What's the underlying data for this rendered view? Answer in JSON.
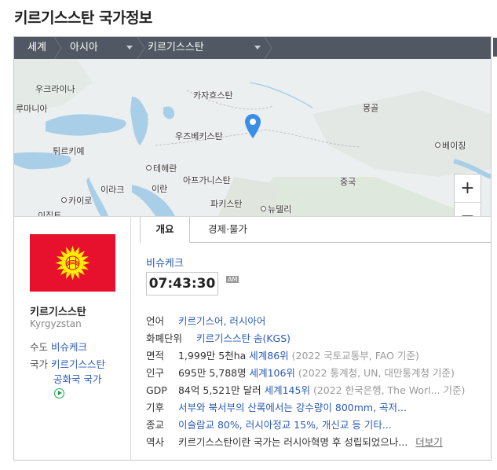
{
  "page_title": "키르기스스탄 국가정보",
  "breadcrumb": {
    "world": "세계",
    "region": "아시아",
    "country": "키르기스스탄"
  },
  "map": {
    "labels": {
      "ukraine": "우크라이나",
      "romania": "루마니아",
      "kazakhstan": "카자흐스탄",
      "mongolia": "몽골",
      "uzbekistan": "우즈베키스탄",
      "turkey": "튀르키예",
      "beijing": "베이징",
      "tehran": "테헤란",
      "afghanistan": "아프가니스탄",
      "china": "중국",
      "iraq": "이라크",
      "iran": "이란",
      "pakistan": "파키스탄",
      "cairo": "카이로",
      "newdelhi": "뉴델리",
      "egypt": "이집트"
    },
    "zoom_in": "+",
    "zoom_out": "−"
  },
  "country": {
    "name": "키르기스스탄",
    "name_en": "Kyrgyzstan",
    "capital_label": "수도",
    "capital": "비슈케크",
    "anthem_label": "국가",
    "anthem_line1": "키르기스스탄",
    "anthem_line2": "공화국 국가"
  },
  "tabs": {
    "overview": "개요",
    "economy": "경제·물가"
  },
  "overview": {
    "city": "비슈케크",
    "time": "07:43:30",
    "ampm": "AM",
    "rows": [
      {
        "key": "언어",
        "link": "키르기스어, 러시아어",
        "text": "",
        "note": ""
      },
      {
        "key": "화폐단위",
        "link": "키르기스스탄 솜(KGS)",
        "text": "",
        "note": ""
      },
      {
        "key": "면적",
        "text": "1,999만 5천ha ",
        "link": "세계86위",
        "note": " (2022 국토교통부, FAO 기준)"
      },
      {
        "key": "인구",
        "text": "695만 5,788명 ",
        "link": "세계106위",
        "note": " (2022 통계청, UN, 대만통계청 기준)"
      },
      {
        "key": "GDP",
        "text": "84억 5,521만 달러 ",
        "link": "세계145위",
        "note": " (2022 한국은행, The Worl...  기준)"
      },
      {
        "key": "기후",
        "link": "서부와 북서부의 산록에서는 강수량이 800mm, 곡저...",
        "text": "",
        "note": ""
      },
      {
        "key": "종교",
        "link": "이슬람교 80%, 러시아정교 15%, 개신교 등 기타...",
        "text": "",
        "note": ""
      },
      {
        "key": "역사",
        "text": "키르기스스탄이란 국가는 러시아혁명 후 성립되었으나...",
        "link": "",
        "note": "",
        "more": "더보기"
      }
    ]
  },
  "colors": {
    "breadcrumb_bg": "#515863",
    "link": "#2a5bb5",
    "flag_red": "#e8112d",
    "flag_yellow": "#ffef00",
    "marker": "#3a8ee6"
  }
}
